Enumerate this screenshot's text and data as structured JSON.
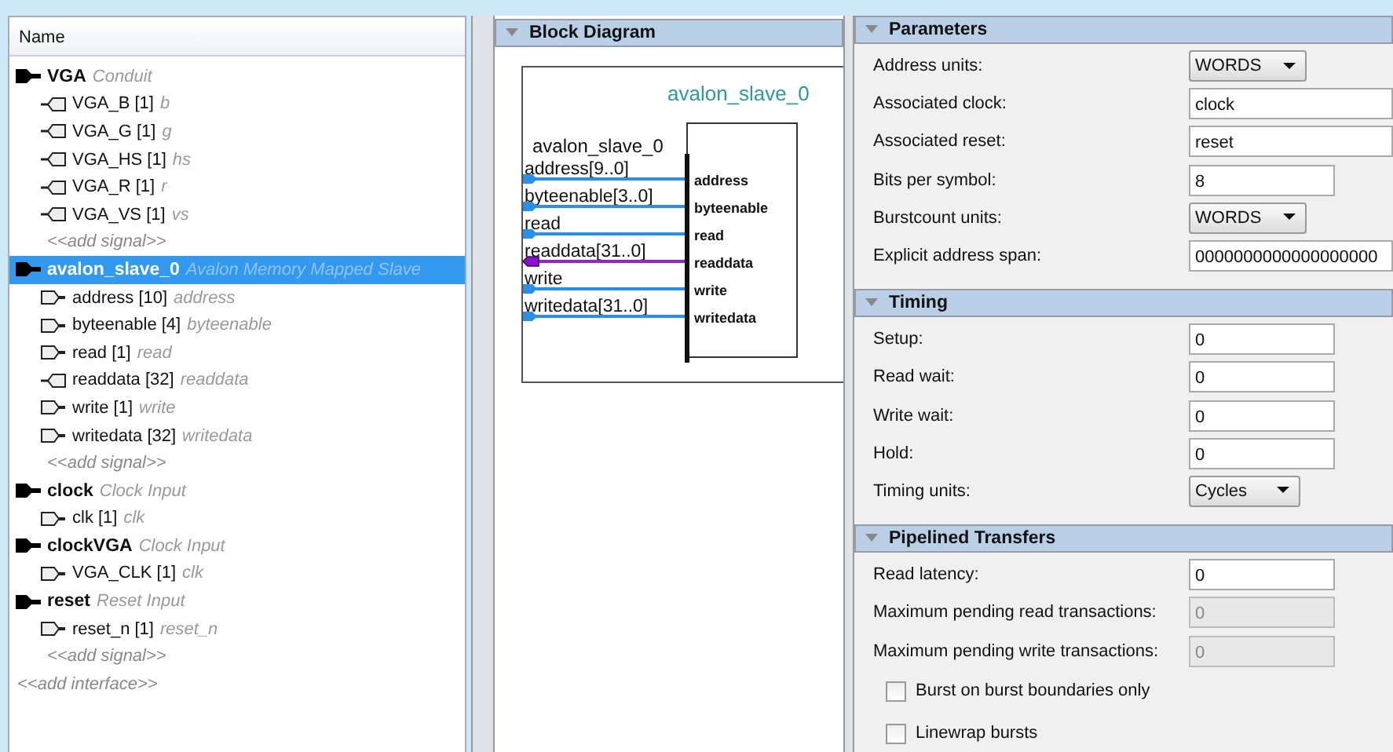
{
  "tree": {
    "header": "Name",
    "interfaces": [
      {
        "name": "VGA",
        "type": "Conduit",
        "selected": false,
        "signals": [
          {
            "name": "VGA_B [1]",
            "role": "b",
            "kind": "output"
          },
          {
            "name": "VGA_G [1]",
            "role": "g",
            "kind": "output"
          },
          {
            "name": "VGA_HS [1]",
            "role": "hs",
            "kind": "output"
          },
          {
            "name": "VGA_R [1]",
            "role": "r",
            "kind": "output"
          },
          {
            "name": "VGA_VS [1]",
            "role": "vs",
            "kind": "output"
          }
        ],
        "add_signal": "<<add signal>>"
      },
      {
        "name": "avalon_slave_0",
        "type": "Avalon Memory Mapped Slave",
        "selected": true,
        "signals": [
          {
            "name": "address [10]",
            "role": "address",
            "kind": "input"
          },
          {
            "name": "byteenable [4]",
            "role": "byteenable",
            "kind": "input"
          },
          {
            "name": "read [1]",
            "role": "read",
            "kind": "input"
          },
          {
            "name": "readdata [32]",
            "role": "readdata",
            "kind": "output"
          },
          {
            "name": "write [1]",
            "role": "write",
            "kind": "input"
          },
          {
            "name": "writedata [32]",
            "role": "writedata",
            "kind": "input"
          }
        ],
        "add_signal": "<<add signal>>"
      },
      {
        "name": "clock",
        "type": "Clock Input",
        "selected": false,
        "signals": [
          {
            "name": "clk [1]",
            "role": "clk",
            "kind": "input"
          }
        ]
      },
      {
        "name": "clockVGA",
        "type": "Clock Input",
        "selected": false,
        "signals": [
          {
            "name": "VGA_CLK [1]",
            "role": "clk",
            "kind": "input"
          }
        ]
      },
      {
        "name": "reset",
        "type": "Reset Input",
        "selected": false,
        "signals": [
          {
            "name": "reset_n [1]",
            "role": "reset_n",
            "kind": "input"
          }
        ],
        "add_signal": "<<add signal>>"
      }
    ],
    "add_interface": "<<add interface>>"
  },
  "diagram": {
    "title": "Block Diagram",
    "component": "avalon_slave_0",
    "interface": "avalon_slave_0",
    "ports": [
      {
        "label": "address[9..0]",
        "pin": "address",
        "kind": "input"
      },
      {
        "label": "byteenable[3..0]",
        "pin": "byteenable",
        "kind": "input"
      },
      {
        "label": "read",
        "pin": "read",
        "kind": "input"
      },
      {
        "label": "readdata[31..0]",
        "pin": "readdata",
        "kind": "output"
      },
      {
        "label": "write",
        "pin": "write",
        "kind": "input"
      },
      {
        "label": "writedata[31..0]",
        "pin": "writedata",
        "kind": "input"
      }
    ]
  },
  "sections": [
    {
      "title": "Parameters",
      "rows": [
        {
          "kind": "dropdown",
          "label": "Address units:",
          "value": "WORDS",
          "disabled": false
        },
        {
          "kind": "text",
          "label": "Associated clock:",
          "value": "clock",
          "disabled": false
        },
        {
          "kind": "text",
          "label": "Associated reset:",
          "value": "reset",
          "disabled": false
        },
        {
          "kind": "number",
          "label": "Bits per symbol:",
          "value": "8",
          "disabled": false
        },
        {
          "kind": "dropdown",
          "label": "Burstcount units:",
          "value": "WORDS",
          "disabled": false
        },
        {
          "kind": "text",
          "label": "Explicit address span:",
          "value": "0000000000000000000",
          "disabled": false
        }
      ]
    },
    {
      "title": "Timing",
      "rows": [
        {
          "kind": "number",
          "label": "Setup:",
          "value": "0",
          "disabled": false
        },
        {
          "kind": "number",
          "label": "Read wait:",
          "value": "0",
          "disabled": false
        },
        {
          "kind": "number",
          "label": "Write wait:",
          "value": "0",
          "disabled": false
        },
        {
          "kind": "number",
          "label": "Hold:",
          "value": "0",
          "disabled": false
        },
        {
          "kind": "dropdown",
          "label": "Timing units:",
          "value": "Cycles",
          "disabled": false
        }
      ]
    },
    {
      "title": "Pipelined Transfers",
      "rows": [
        {
          "kind": "number",
          "label": "Read latency:",
          "value": "0",
          "disabled": false
        },
        {
          "kind": "number",
          "label": "Maximum pending read transactions:",
          "value": "0",
          "disabled": true
        },
        {
          "kind": "number",
          "label": "Maximum pending write transactions:",
          "value": "0",
          "disabled": true
        },
        {
          "kind": "checkbox",
          "label": "Burst on burst boundaries only",
          "checked": false
        },
        {
          "kind": "checkbox",
          "label": "Linewrap bursts",
          "checked": false
        }
      ]
    }
  ]
}
